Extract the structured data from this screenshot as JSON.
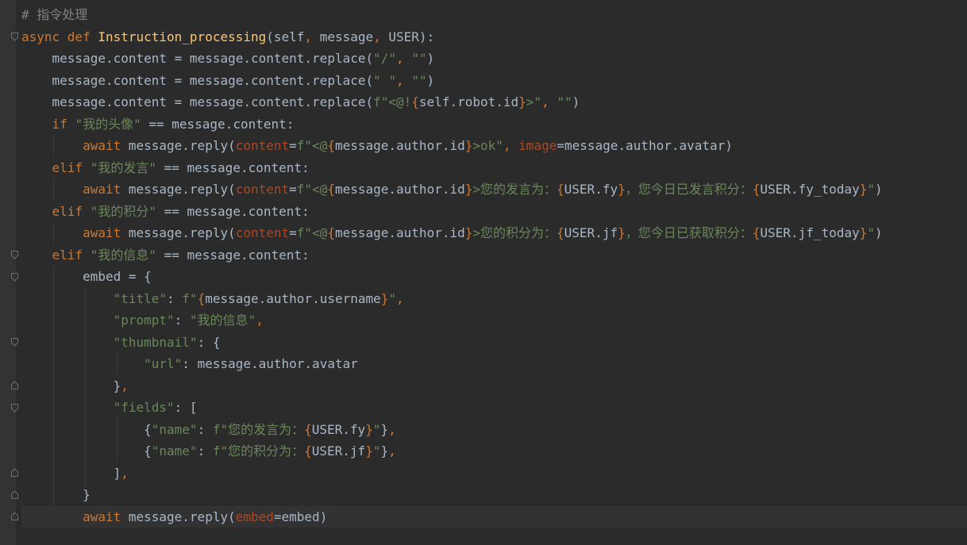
{
  "editor": {
    "language": "python",
    "lines": [
      [
        {
          "t": "# 指令处理",
          "c": "cm"
        }
      ],
      [
        {
          "t": "async def ",
          "c": "kw"
        },
        {
          "t": "Instruction_processing",
          "c": "fn"
        },
        {
          "t": "(self",
          "c": "pl"
        },
        {
          "t": ", ",
          "c": "kw"
        },
        {
          "t": "message",
          "c": "pl"
        },
        {
          "t": ", ",
          "c": "kw"
        },
        {
          "t": "USER):",
          "c": "pl"
        }
      ],
      [
        {
          "t": "    message.content = message.content.replace(",
          "c": "pl"
        },
        {
          "t": "\"/\"",
          "c": "st"
        },
        {
          "t": ", ",
          "c": "kw"
        },
        {
          "t": "\"\"",
          "c": "st"
        },
        {
          "t": ")",
          "c": "pl"
        }
      ],
      [
        {
          "t": "    message.content = message.content.replace(",
          "c": "pl"
        },
        {
          "t": "\" \"",
          "c": "st"
        },
        {
          "t": ", ",
          "c": "kw"
        },
        {
          "t": "\"\"",
          "c": "st"
        },
        {
          "t": ")",
          "c": "pl"
        }
      ],
      [
        {
          "t": "    message.content = message.content.replace(",
          "c": "pl"
        },
        {
          "t": "f\"<@!",
          "c": "st"
        },
        {
          "t": "{",
          "c": "br"
        },
        {
          "t": "self.robot.id",
          "c": "pl"
        },
        {
          "t": "}",
          "c": "br"
        },
        {
          "t": ">\"",
          "c": "st"
        },
        {
          "t": ", ",
          "c": "kw"
        },
        {
          "t": "\"\"",
          "c": "st"
        },
        {
          "t": ")",
          "c": "pl"
        }
      ],
      [
        {
          "t": "    ",
          "c": "pl"
        },
        {
          "t": "if ",
          "c": "kw"
        },
        {
          "t": "\"我的头像\"",
          "c": "st"
        },
        {
          "t": " == message.content:",
          "c": "pl"
        }
      ],
      [
        {
          "t": "        ",
          "c": "pl"
        },
        {
          "t": "await ",
          "c": "kw"
        },
        {
          "t": "message.reply(",
          "c": "pl"
        },
        {
          "t": "content",
          "c": "pa"
        },
        {
          "t": "=",
          "c": "pl"
        },
        {
          "t": "f\"<@",
          "c": "st"
        },
        {
          "t": "{",
          "c": "br"
        },
        {
          "t": "message.author.id",
          "c": "pl"
        },
        {
          "t": "}",
          "c": "br"
        },
        {
          "t": ">ok\"",
          "c": "st"
        },
        {
          "t": ", ",
          "c": "kw"
        },
        {
          "t": "image",
          "c": "pa"
        },
        {
          "t": "=message.author.avatar)",
          "c": "pl"
        }
      ],
      [
        {
          "t": "    ",
          "c": "pl"
        },
        {
          "t": "elif ",
          "c": "kw"
        },
        {
          "t": "\"我的发言\"",
          "c": "st"
        },
        {
          "t": " == message.content:",
          "c": "pl"
        }
      ],
      [
        {
          "t": "        ",
          "c": "pl"
        },
        {
          "t": "await ",
          "c": "kw"
        },
        {
          "t": "message.reply(",
          "c": "pl"
        },
        {
          "t": "content",
          "c": "pa"
        },
        {
          "t": "=",
          "c": "pl"
        },
        {
          "t": "f\"<@",
          "c": "st"
        },
        {
          "t": "{",
          "c": "br"
        },
        {
          "t": "message.author.id",
          "c": "pl"
        },
        {
          "t": "}",
          "c": "br"
        },
        {
          "t": ">您的发言为：",
          "c": "st"
        },
        {
          "t": "{",
          "c": "br"
        },
        {
          "t": "USER.fy",
          "c": "pl"
        },
        {
          "t": "}",
          "c": "br"
        },
        {
          "t": "，您今日已发言积分：",
          "c": "st"
        },
        {
          "t": "{",
          "c": "br"
        },
        {
          "t": "USER.fy_today",
          "c": "pl"
        },
        {
          "t": "}",
          "c": "br"
        },
        {
          "t": "\"",
          "c": "st"
        },
        {
          "t": ")",
          "c": "pl"
        }
      ],
      [
        {
          "t": "    ",
          "c": "pl"
        },
        {
          "t": "elif ",
          "c": "kw"
        },
        {
          "t": "\"我的积分\"",
          "c": "st"
        },
        {
          "t": " == message.content:",
          "c": "pl"
        }
      ],
      [
        {
          "t": "        ",
          "c": "pl"
        },
        {
          "t": "await ",
          "c": "kw"
        },
        {
          "t": "message.reply(",
          "c": "pl"
        },
        {
          "t": "content",
          "c": "pa"
        },
        {
          "t": "=",
          "c": "pl"
        },
        {
          "t": "f\"<@",
          "c": "st"
        },
        {
          "t": "{",
          "c": "br"
        },
        {
          "t": "message.author.id",
          "c": "pl"
        },
        {
          "t": "}",
          "c": "br"
        },
        {
          "t": ">您的积分为：",
          "c": "st"
        },
        {
          "t": "{",
          "c": "br"
        },
        {
          "t": "USER.jf",
          "c": "pl"
        },
        {
          "t": "}",
          "c": "br"
        },
        {
          "t": "，您今日已获取积分：",
          "c": "st"
        },
        {
          "t": "{",
          "c": "br"
        },
        {
          "t": "USER.jf_today",
          "c": "pl"
        },
        {
          "t": "}",
          "c": "br"
        },
        {
          "t": "\"",
          "c": "st"
        },
        {
          "t": ")",
          "c": "pl"
        }
      ],
      [
        {
          "t": "    ",
          "c": "pl"
        },
        {
          "t": "elif ",
          "c": "kw"
        },
        {
          "t": "\"我的信息\"",
          "c": "st"
        },
        {
          "t": " == message.content:",
          "c": "pl"
        }
      ],
      [
        {
          "t": "        embed = {",
          "c": "pl"
        }
      ],
      [
        {
          "t": "            ",
          "c": "pl"
        },
        {
          "t": "\"title\"",
          "c": "st"
        },
        {
          "t": ": ",
          "c": "pl"
        },
        {
          "t": "f\"",
          "c": "st"
        },
        {
          "t": "{",
          "c": "br"
        },
        {
          "t": "message.author.username",
          "c": "pl"
        },
        {
          "t": "}",
          "c": "br"
        },
        {
          "t": "\"",
          "c": "st"
        },
        {
          "t": ",",
          "c": "kw"
        }
      ],
      [
        {
          "t": "            ",
          "c": "pl"
        },
        {
          "t": "\"prompt\"",
          "c": "st"
        },
        {
          "t": ": ",
          "c": "pl"
        },
        {
          "t": "\"我的信息\"",
          "c": "st"
        },
        {
          "t": ",",
          "c": "kw"
        }
      ],
      [
        {
          "t": "            ",
          "c": "pl"
        },
        {
          "t": "\"thumbnail\"",
          "c": "st"
        },
        {
          "t": ": {",
          "c": "pl"
        }
      ],
      [
        {
          "t": "                ",
          "c": "pl"
        },
        {
          "t": "\"url\"",
          "c": "st"
        },
        {
          "t": ": message.author.avatar",
          "c": "pl"
        }
      ],
      [
        {
          "t": "            }",
          "c": "pl"
        },
        {
          "t": ",",
          "c": "kw"
        }
      ],
      [
        {
          "t": "            ",
          "c": "pl"
        },
        {
          "t": "\"fields\"",
          "c": "st"
        },
        {
          "t": ": [",
          "c": "pl"
        }
      ],
      [
        {
          "t": "                {",
          "c": "pl"
        },
        {
          "t": "\"name\"",
          "c": "st"
        },
        {
          "t": ": ",
          "c": "pl"
        },
        {
          "t": "f\"您的发言为：",
          "c": "st"
        },
        {
          "t": "{",
          "c": "br"
        },
        {
          "t": "USER.fy",
          "c": "pl"
        },
        {
          "t": "}",
          "c": "br"
        },
        {
          "t": "\"",
          "c": "st"
        },
        {
          "t": "}",
          "c": "pl"
        },
        {
          "t": ",",
          "c": "kw"
        }
      ],
      [
        {
          "t": "                {",
          "c": "pl"
        },
        {
          "t": "\"name\"",
          "c": "st"
        },
        {
          "t": ": ",
          "c": "pl"
        },
        {
          "t": "f\"您的积分为：",
          "c": "st"
        },
        {
          "t": "{",
          "c": "br"
        },
        {
          "t": "USER.jf",
          "c": "pl"
        },
        {
          "t": "}",
          "c": "br"
        },
        {
          "t": "\"",
          "c": "st"
        },
        {
          "t": "}",
          "c": "pl"
        },
        {
          "t": ",",
          "c": "kw"
        }
      ],
      [
        {
          "t": "            ]",
          "c": "pl"
        },
        {
          "t": ",",
          "c": "kw"
        }
      ],
      [
        {
          "t": "        }",
          "c": "pl"
        }
      ],
      [
        {
          "t": "        ",
          "c": "pl"
        },
        {
          "t": "await ",
          "c": "kw"
        },
        {
          "t": "message.reply(",
          "c": "pl"
        },
        {
          "t": "embed",
          "c": "pa"
        },
        {
          "t": "=embed)",
          "c": "pl"
        }
      ]
    ],
    "current_line": 23,
    "colors": {
      "background": "#2b2b2b",
      "gutter": "#313335",
      "keyword": "#cc7832",
      "function": "#ffc66d",
      "string": "#6a8759",
      "param": "#aa4926",
      "comment": "#808080",
      "text": "#a9b7c6"
    }
  }
}
